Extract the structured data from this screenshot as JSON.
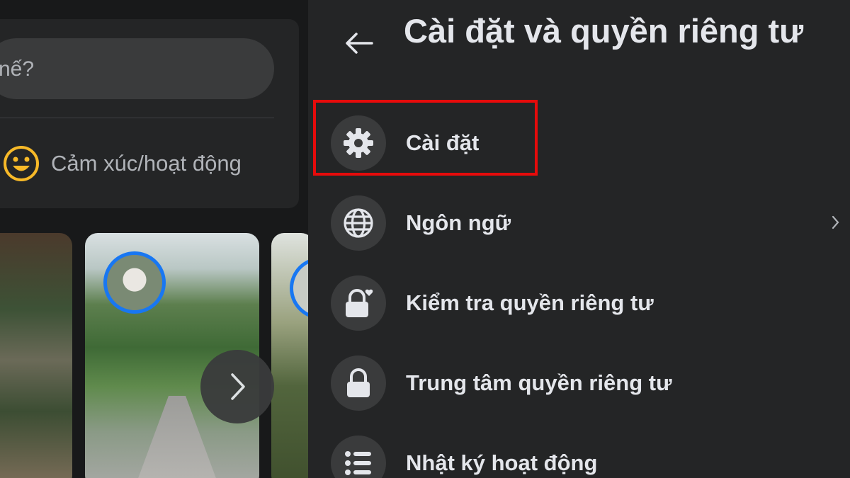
{
  "composer": {
    "placeholder_partial": "nế?",
    "feeling_label": "Cảm xúc/hoạt động"
  },
  "settings_panel": {
    "title": "Cài đặt và quyền riêng tư",
    "items": [
      {
        "label": "Cài đặt",
        "icon": "gear-icon",
        "highlighted": true
      },
      {
        "label": "Ngôn ngữ",
        "icon": "globe-icon",
        "has_submenu": true
      },
      {
        "label": "Kiểm tra quyền riêng tư",
        "icon": "lock-heart-icon"
      },
      {
        "label": "Trung tâm quyền riêng tư",
        "icon": "lock-icon"
      },
      {
        "label": "Nhật ký hoạt động",
        "icon": "list-icon"
      }
    ]
  },
  "colors": {
    "background": "#18191a",
    "panel": "#242526",
    "icon_circle": "#3a3b3c",
    "text_primary": "#e4e6eb",
    "text_secondary": "#b0b3b8",
    "story_ring": "#1877f2",
    "highlight_box": "#e60b0b",
    "emoji_yellow": "#f7b928"
  }
}
